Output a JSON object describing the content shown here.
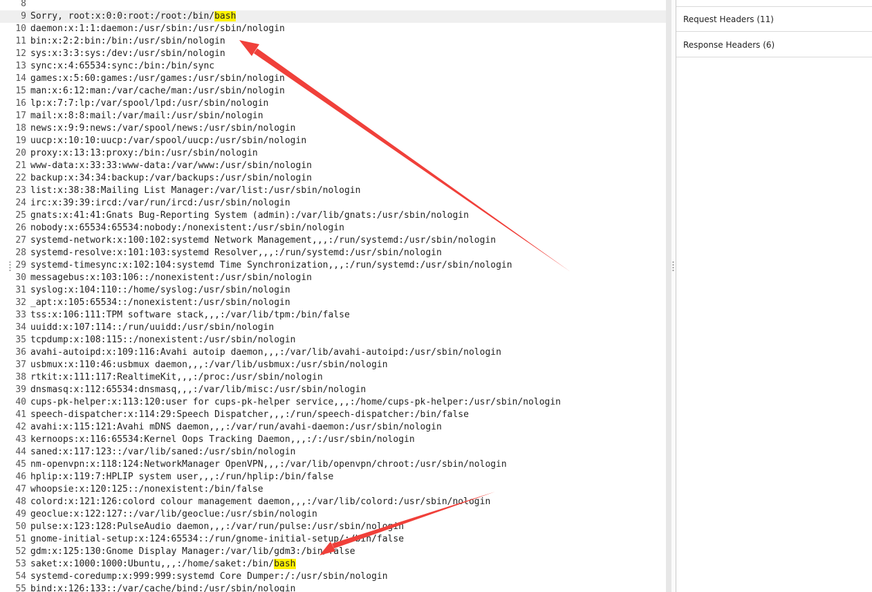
{
  "editor": {
    "lines": [
      {
        "n": "8",
        "text": ""
      },
      {
        "n": "9",
        "pre": "Sorry, root:x:0:0:root:/root:/bin/",
        "hl": "bash",
        "post": ""
      },
      {
        "n": "10",
        "text": "daemon:x:1:1:daemon:/usr/sbin:/usr/sbin/nologin"
      },
      {
        "n": "11",
        "text": "bin:x:2:2:bin:/bin:/usr/sbin/nologin"
      },
      {
        "n": "12",
        "text": "sys:x:3:3:sys:/dev:/usr/sbin/nologin"
      },
      {
        "n": "13",
        "text": "sync:x:4:65534:sync:/bin:/bin/sync"
      },
      {
        "n": "14",
        "text": "games:x:5:60:games:/usr/games:/usr/sbin/nologin"
      },
      {
        "n": "15",
        "text": "man:x:6:12:man:/var/cache/man:/usr/sbin/nologin"
      },
      {
        "n": "16",
        "text": "lp:x:7:7:lp:/var/spool/lpd:/usr/sbin/nologin"
      },
      {
        "n": "17",
        "text": "mail:x:8:8:mail:/var/mail:/usr/sbin/nologin"
      },
      {
        "n": "18",
        "text": "news:x:9:9:news:/var/spool/news:/usr/sbin/nologin"
      },
      {
        "n": "19",
        "text": "uucp:x:10:10:uucp:/var/spool/uucp:/usr/sbin/nologin"
      },
      {
        "n": "20",
        "text": "proxy:x:13:13:proxy:/bin:/usr/sbin/nologin"
      },
      {
        "n": "21",
        "text": "www-data:x:33:33:www-data:/var/www:/usr/sbin/nologin"
      },
      {
        "n": "22",
        "text": "backup:x:34:34:backup:/var/backups:/usr/sbin/nologin"
      },
      {
        "n": "23",
        "text": "list:x:38:38:Mailing List Manager:/var/list:/usr/sbin/nologin"
      },
      {
        "n": "24",
        "text": "irc:x:39:39:ircd:/var/run/ircd:/usr/sbin/nologin"
      },
      {
        "n": "25",
        "text": "gnats:x:41:41:Gnats Bug-Reporting System (admin):/var/lib/gnats:/usr/sbin/nologin"
      },
      {
        "n": "26",
        "text": "nobody:x:65534:65534:nobody:/nonexistent:/usr/sbin/nologin"
      },
      {
        "n": "27",
        "text": "systemd-network:x:100:102:systemd Network Management,,,:/run/systemd:/usr/sbin/nologin"
      },
      {
        "n": "28",
        "text": "systemd-resolve:x:101:103:systemd Resolver,,,:/run/systemd:/usr/sbin/nologin"
      },
      {
        "n": "29",
        "text": "systemd-timesync:x:102:104:systemd Time Synchronization,,,:/run/systemd:/usr/sbin/nologin"
      },
      {
        "n": "30",
        "text": "messagebus:x:103:106::/nonexistent:/usr/sbin/nologin"
      },
      {
        "n": "31",
        "text": "syslog:x:104:110::/home/syslog:/usr/sbin/nologin"
      },
      {
        "n": "32",
        "text": "_apt:x:105:65534::/nonexistent:/usr/sbin/nologin"
      },
      {
        "n": "33",
        "text": "tss:x:106:111:TPM software stack,,,:/var/lib/tpm:/bin/false"
      },
      {
        "n": "34",
        "text": "uuidd:x:107:114::/run/uuidd:/usr/sbin/nologin"
      },
      {
        "n": "35",
        "text": "tcpdump:x:108:115::/nonexistent:/usr/sbin/nologin"
      },
      {
        "n": "36",
        "text": "avahi-autoipd:x:109:116:Avahi autoip daemon,,,:/var/lib/avahi-autoipd:/usr/sbin/nologin"
      },
      {
        "n": "37",
        "text": "usbmux:x:110:46:usbmux daemon,,,:/var/lib/usbmux:/usr/sbin/nologin"
      },
      {
        "n": "38",
        "text": "rtkit:x:111:117:RealtimeKit,,,:/proc:/usr/sbin/nologin"
      },
      {
        "n": "39",
        "text": "dnsmasq:x:112:65534:dnsmasq,,,:/var/lib/misc:/usr/sbin/nologin"
      },
      {
        "n": "40",
        "text": "cups-pk-helper:x:113:120:user for cups-pk-helper service,,,:/home/cups-pk-helper:/usr/sbin/nologin"
      },
      {
        "n": "41",
        "text": "speech-dispatcher:x:114:29:Speech Dispatcher,,,:/run/speech-dispatcher:/bin/false"
      },
      {
        "n": "42",
        "text": "avahi:x:115:121:Avahi mDNS daemon,,,:/var/run/avahi-daemon:/usr/sbin/nologin"
      },
      {
        "n": "43",
        "text": "kernoops:x:116:65534:Kernel Oops Tracking Daemon,,,:/:/usr/sbin/nologin"
      },
      {
        "n": "44",
        "text": "saned:x:117:123::/var/lib/saned:/usr/sbin/nologin"
      },
      {
        "n": "45",
        "text": "nm-openvpn:x:118:124:NetworkManager OpenVPN,,,:/var/lib/openvpn/chroot:/usr/sbin/nologin"
      },
      {
        "n": "46",
        "text": "hplip:x:119:7:HPLIP system user,,,:/run/hplip:/bin/false"
      },
      {
        "n": "47",
        "text": "whoopsie:x:120:125::/nonexistent:/bin/false"
      },
      {
        "n": "48",
        "text": "colord:x:121:126:colord colour management daemon,,,:/var/lib/colord:/usr/sbin/nologin"
      },
      {
        "n": "49",
        "text": "geoclue:x:122:127::/var/lib/geoclue:/usr/sbin/nologin"
      },
      {
        "n": "50",
        "text": "pulse:x:123:128:PulseAudio daemon,,,:/var/run/pulse:/usr/sbin/nologin"
      },
      {
        "n": "51",
        "text": "gnome-initial-setup:x:124:65534::/run/gnome-initial-setup/:/bin/false"
      },
      {
        "n": "52",
        "text": "gdm:x:125:130:Gnome Display Manager:/var/lib/gdm3:/bin/false"
      },
      {
        "n": "53",
        "pre": "saket:x:1000:1000:Ubuntu,,,:/home/saket:/bin/",
        "hl": "bash",
        "post": ""
      },
      {
        "n": "54",
        "text": "systemd-coredump:x:999:999:systemd Core Dumper:/:/usr/sbin/nologin"
      },
      {
        "n": "55",
        "text": "bind:x:126:133::/var/cache/bind:/usr/sbin/nologin"
      }
    ]
  },
  "inspector": {
    "request_headers": "Request Headers (11)",
    "response_headers": "Response Headers (6)"
  },
  "colors": {
    "highlight": "#fff200",
    "arrow": "#f0403a",
    "current_line": "#efefef"
  }
}
